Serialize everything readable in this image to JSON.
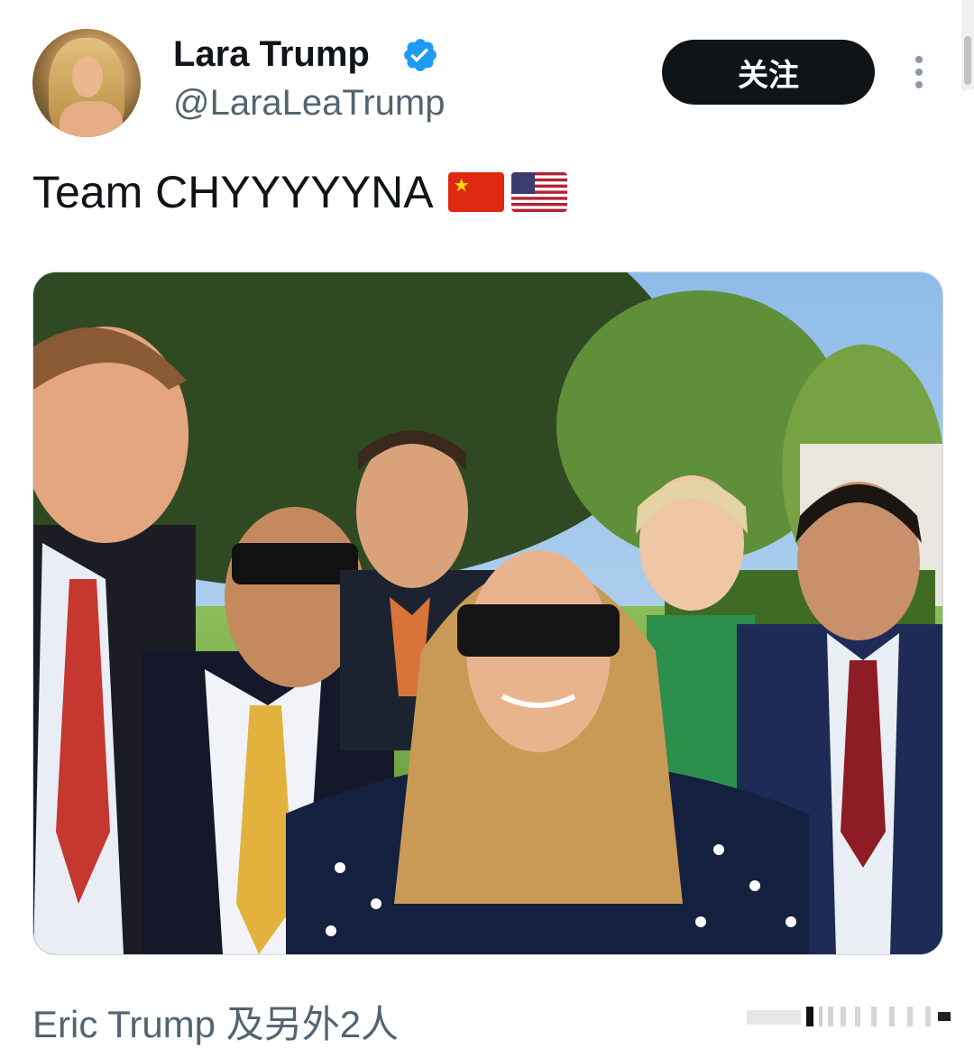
{
  "tweet": {
    "author": {
      "display_name": "Lara Trump",
      "handle": "@LaraLeaTrump",
      "verified": true,
      "avatar_icon": "profile-photo"
    },
    "follow_label": "关注",
    "more_icon": "vertical-ellipsis-icon",
    "text": "Team CHYYYYYNA",
    "emoji": [
      "china-flag",
      "usa-flag"
    ],
    "media": {
      "type": "photo",
      "description_icon": "group-selfie-photo"
    },
    "tagged_people": "Eric Trump 及另外2人"
  },
  "colors": {
    "text_primary": "#0f1419",
    "text_secondary": "#536471",
    "verified_blue": "#1d9bf0",
    "button_bg": "#0f1419"
  }
}
